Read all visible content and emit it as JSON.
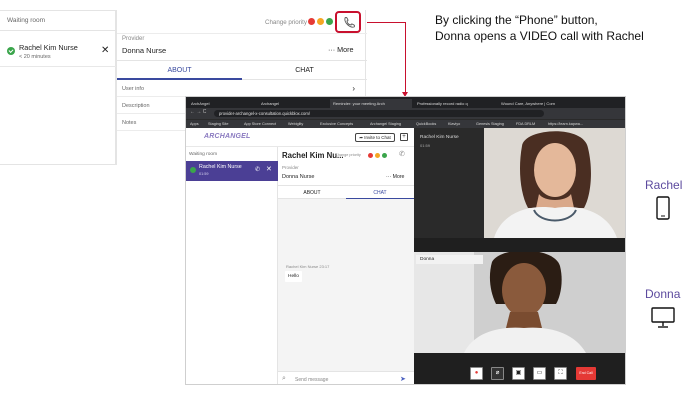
{
  "annotation": {
    "line1": "By clicking the “Phone” button,",
    "line2": "Donna opens a VIDEO call with Rachel"
  },
  "top_panel": {
    "waiting_room": "Waiting room",
    "patient_name": "Rachel Kim Nurse",
    "patient_time": "< 20 minutes",
    "change_priority": "Change priority",
    "provider_label": "Provider",
    "provider_name": "Donna Nurse",
    "more": "··· More",
    "tab_about": "ABOUT",
    "tab_chat": "CHAT",
    "user_info": "User info",
    "description": "Description",
    "notes": "Notes",
    "priority_colors": [
      "#e53935",
      "#f5a623",
      "#3aa54b"
    ]
  },
  "browser": {
    "tabs": [
      "ArchAngel",
      "Archangel",
      "Reminder: your meeting Arch",
      "Professionally record radio q",
      "Wound Care, Anywhere | Corn"
    ],
    "url": "provider-archangel-x-consultation.quickblox.com/",
    "bookmarks": [
      "Apps",
      "Staging Site",
      "App Store Connect",
      "Webiglity",
      "Exclusive Concepts",
      "Archangel Staging",
      "QuickBooks",
      "Klaviyo",
      "Genesis Staging",
      "FDA DRLM",
      "https://learn.kapwa..."
    ]
  },
  "app": {
    "logo": "ARCHANGEL",
    "invite_button": "Invite to Chat",
    "waiting_room": "Waiting room",
    "patient_name": "Rachel Kim Nurse",
    "patient_time": "01:59",
    "header_name": "Rachel Kim Nu...",
    "change_priority": "Change priority",
    "provider_label": "Provider",
    "provider_name": "Donna Nurse",
    "more": "··· More",
    "tab_about": "ABOUT",
    "tab_chat": "CHAT",
    "msg_meta": "Rachel Kim Nurse 23:17",
    "msg_text": "Hello",
    "send_placeholder": "Send message"
  },
  "video": {
    "remote_name": "Rachel Kim Nurse",
    "remote_time": "01:59",
    "local_name": "Donna",
    "end_call": "End Call"
  },
  "side": {
    "rachel": "Rachel",
    "donna": "Donna"
  }
}
